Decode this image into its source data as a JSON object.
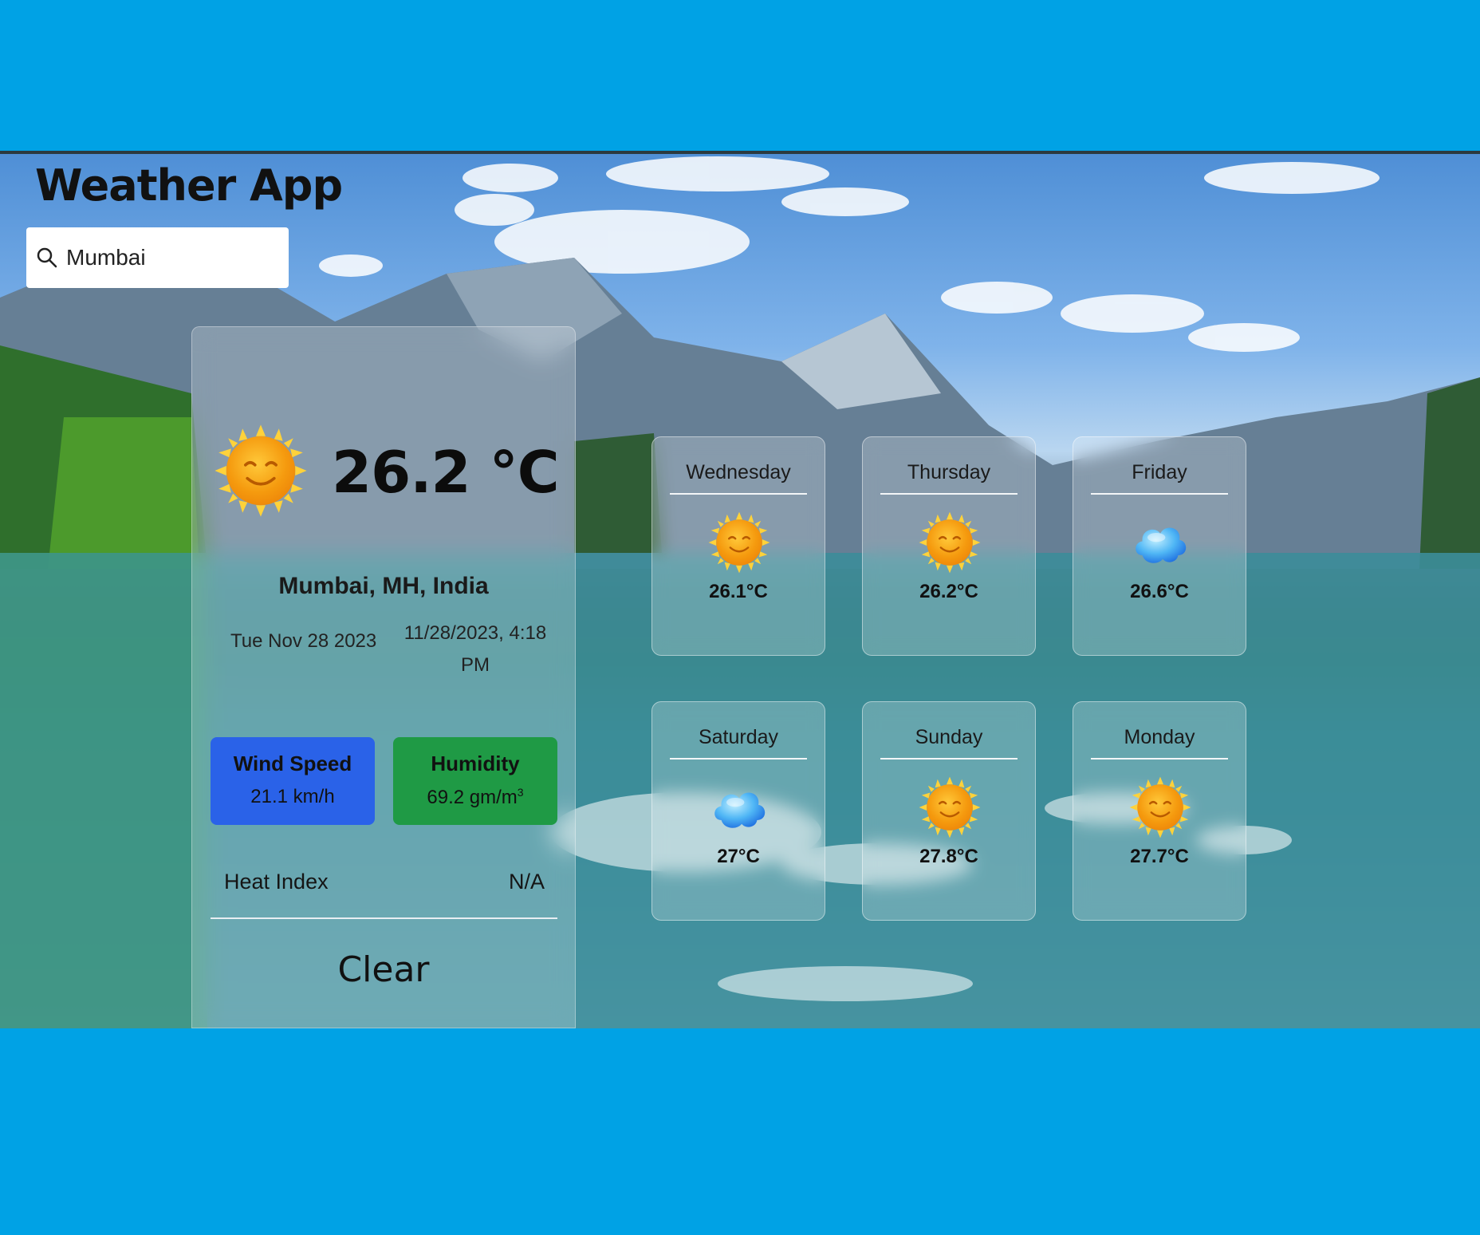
{
  "app": {
    "title": "Weather App"
  },
  "search": {
    "value": "Mumbai",
    "icon": "search-icon"
  },
  "current": {
    "temperature": "26.2 °C",
    "location": "Mumbai, MH, India",
    "date": "Tue Nov 28 2023",
    "datetime": "11/28/2023, 4:18 PM",
    "wind": {
      "label": "Wind Speed",
      "value": "21.1 km/h",
      "color": "#2a62e8"
    },
    "humidity": {
      "label": "Humidity",
      "value": "69.2 gm/m",
      "unit_sup": "3",
      "color": "#1f9a45"
    },
    "heat_index": {
      "label": "Heat Index",
      "value": "N/A"
    },
    "condition": "Clear",
    "icon": "sun-icon"
  },
  "forecast": [
    {
      "day": "Wednesday",
      "temp": "26.1°C",
      "icon": "sun-icon"
    },
    {
      "day": "Thursday",
      "temp": "26.2°C",
      "icon": "sun-icon"
    },
    {
      "day": "Friday",
      "temp": "26.6°C",
      "icon": "cloud-icon"
    },
    {
      "day": "Saturday",
      "temp": "27°C",
      "icon": "cloud-icon"
    },
    {
      "day": "Sunday",
      "temp": "27.8°C",
      "icon": "sun-icon"
    },
    {
      "day": "Monday",
      "temp": "27.7°C",
      "icon": "sun-icon"
    }
  ]
}
